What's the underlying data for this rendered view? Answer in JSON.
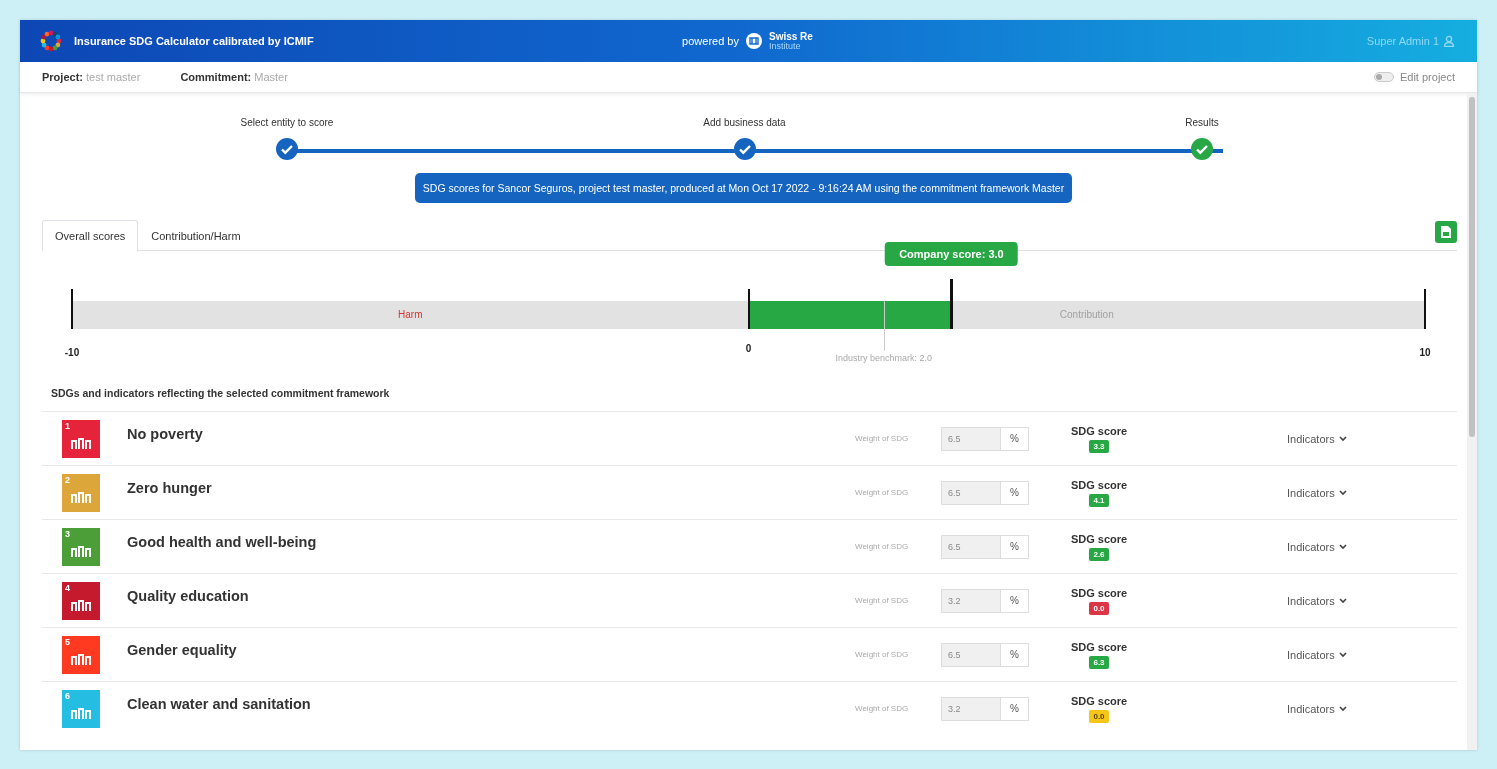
{
  "header": {
    "title": "Insurance SDG Calculator calibrated by ICMIF",
    "powered_by": "powered by",
    "partner_name": "Swiss Re",
    "partner_sub": "Institute",
    "user": "Super Admin 1"
  },
  "project_bar": {
    "project_label": "Project:",
    "project_value": "test master",
    "commitment_label": "Commitment:",
    "commitment_value": "Master",
    "edit_toggle": {
      "label": "Edit project",
      "on": false
    }
  },
  "steps": [
    {
      "label": "Select entity to score",
      "current": false
    },
    {
      "label": "Add business data",
      "current": false
    },
    {
      "label": "Results",
      "current": true
    }
  ],
  "banner": "SDG scores for Sancor Seguros, project test master, produced at Mon Oct 17 2022 - 9:16:24 AM using the commitment framework Master",
  "tabs": [
    {
      "label": "Overall scores",
      "selected": true
    },
    {
      "label": "Contribution/Harm",
      "selected": false
    }
  ],
  "gauge": {
    "harm_label": "Harm",
    "contribution_label": "Contribution",
    "min": "-10",
    "zero": "0",
    "max": "10",
    "company_score": {
      "label": "Company score: 3.0",
      "level": 0.3
    },
    "benchmark": {
      "label": "Industry benchmark: 2.0",
      "level": 0.2
    }
  },
  "section_title": "SDGs and indicators reflecting the selected commitment framework",
  "sdgs": [
    {
      "number": "1",
      "name": "No poverty",
      "color": "#e5243b",
      "weight_label": "Weight of SDG",
      "weight": "6.5",
      "unit": "%",
      "score_label": "SDG score",
      "score": {
        "value": "3.3",
        "color": "#28a745"
      },
      "indicators": "Indicators"
    },
    {
      "number": "2",
      "name": "Zero hunger",
      "color": "#dda63a",
      "weight_label": "Weight of SDG",
      "weight": "6.5",
      "unit": "%",
      "score_label": "SDG score",
      "score": {
        "value": "4.1",
        "color": "#28a745"
      },
      "indicators": "Indicators"
    },
    {
      "number": "3",
      "name": "Good health and well-being",
      "color": "#4c9f38",
      "weight_label": "Weight of SDG",
      "weight": "6.5",
      "unit": "%",
      "score_label": "SDG score",
      "score": {
        "value": "2.6",
        "color": "#28a745"
      },
      "indicators": "Indicators"
    },
    {
      "number": "4",
      "name": "Quality education",
      "color": "#c5192d",
      "weight_label": "Weight of SDG",
      "weight": "3.2",
      "unit": "%",
      "score_label": "SDG score",
      "score": {
        "value": "0.0",
        "color": "#dc3545"
      },
      "indicators": "Indicators"
    },
    {
      "number": "5",
      "name": "Gender equality",
      "color": "#ff3a21",
      "weight_label": "Weight of SDG",
      "weight": "6.5",
      "unit": "%",
      "score_label": "SDG score",
      "score": {
        "value": "6.3",
        "color": "#28a745"
      },
      "indicators": "Indicators"
    },
    {
      "number": "6",
      "name": "Clean water and sanitation",
      "color": "#26bde2",
      "weight_label": "Weight of SDG",
      "weight": "3.2",
      "unit": "%",
      "score_label": "SDG score",
      "score": {
        "value": "0.0",
        "color": "#f5c518"
      },
      "indicators": "Indicators"
    }
  ]
}
